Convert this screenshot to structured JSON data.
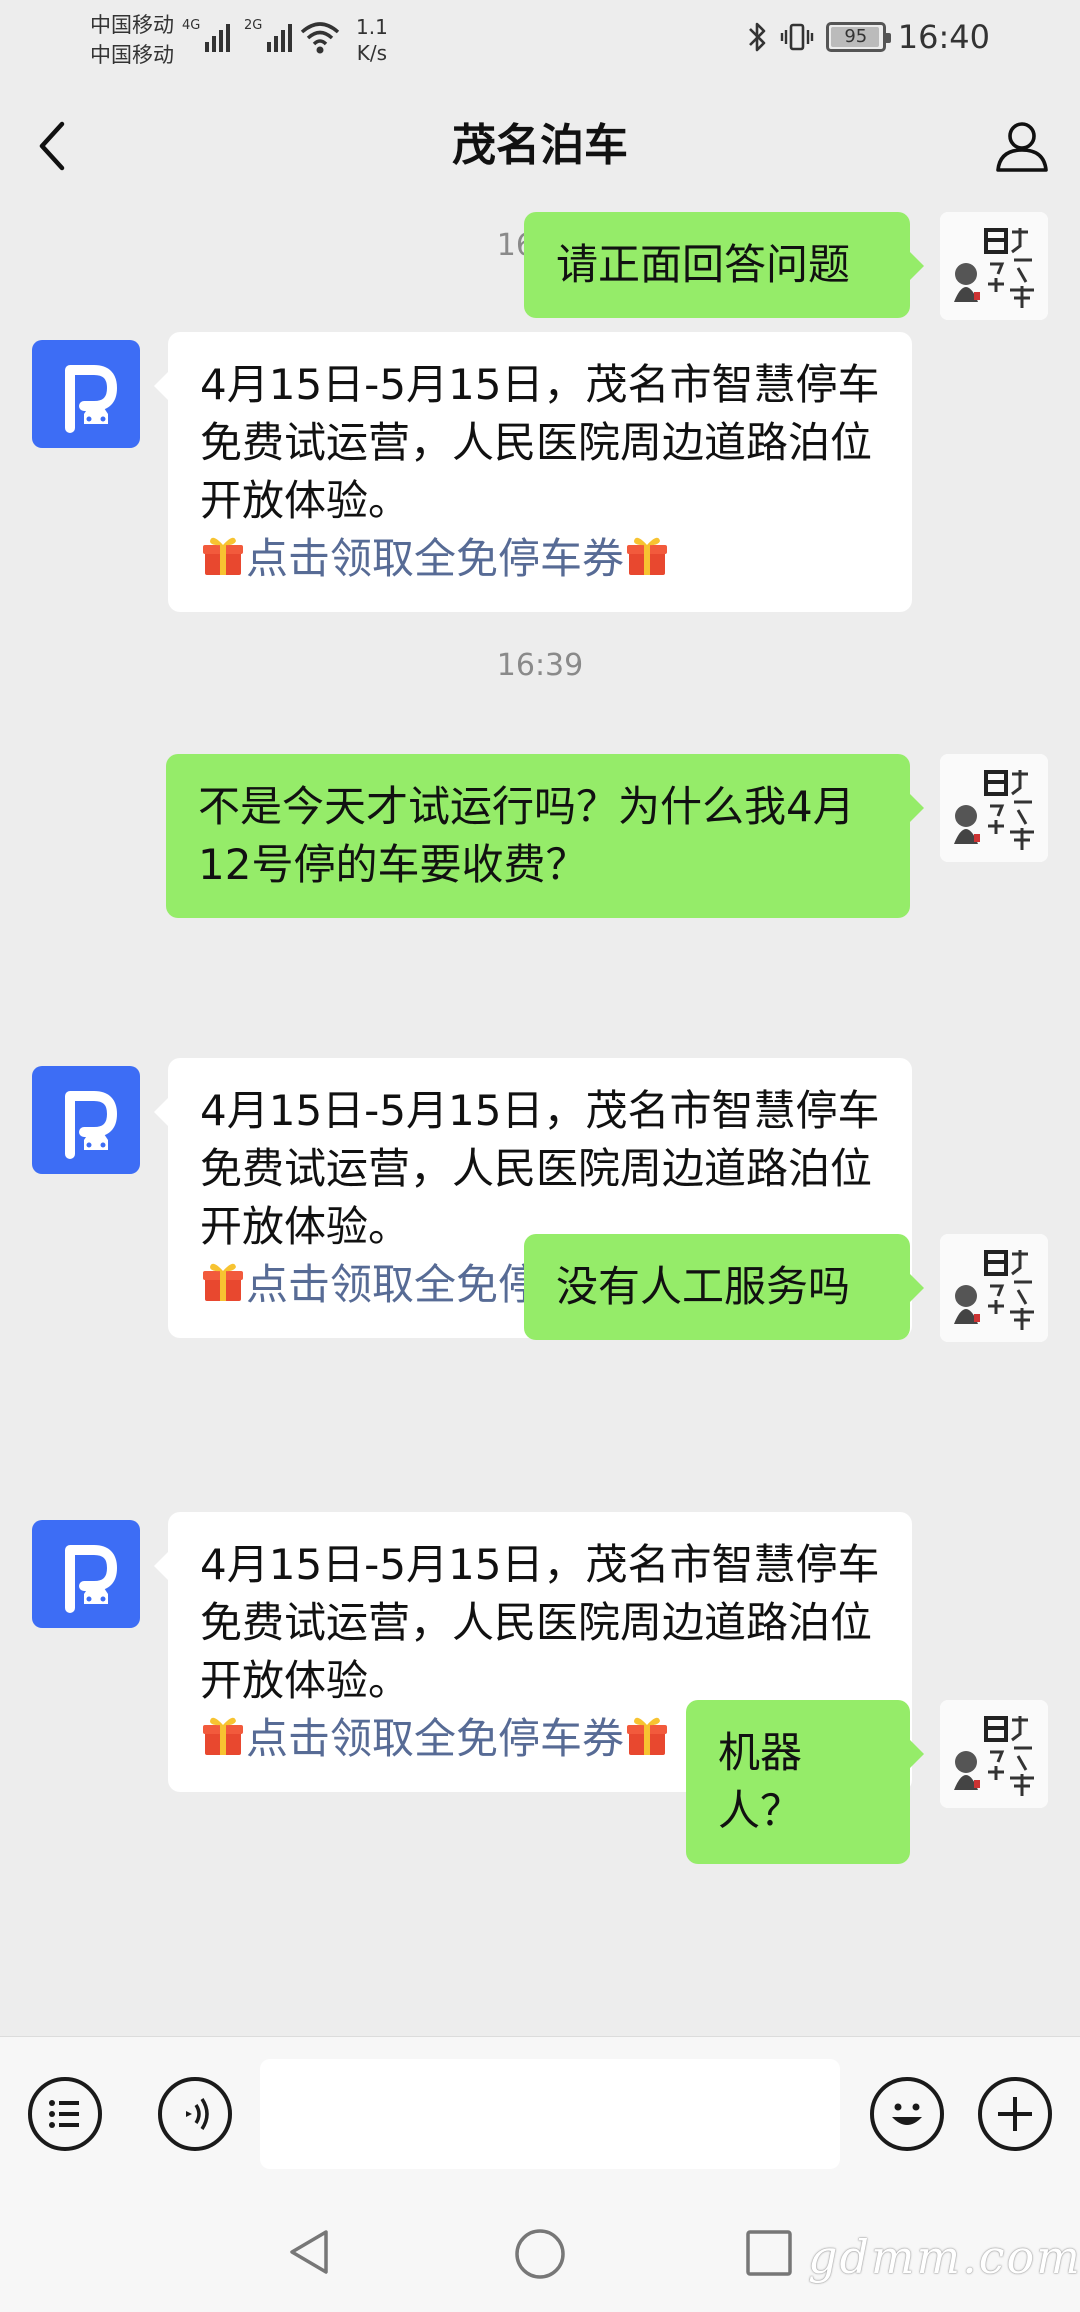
{
  "status_bar": {
    "carrier_1": "中国移动",
    "carrier_2": "中国移动",
    "network_1": "4G",
    "network_2": "2G",
    "speed_value": "1.1",
    "speed_unit": "K/s",
    "battery": "95",
    "time": "16:40"
  },
  "header": {
    "title": "茂名泊车",
    "back_icon": "chevron-left-icon",
    "profile_icon": "person-icon"
  },
  "colors": {
    "app_bg": "#ededed",
    "sent_bubble": "#95ec69",
    "received_bubble": "#ffffff",
    "link": "#576b95",
    "bot_avatar": "#3d6df5"
  },
  "messages": [
    {
      "type": "time",
      "text": "16:23"
    },
    {
      "type": "received",
      "sender": "bot",
      "text": "4月15日-5月15日，茂名市智慧停车免费试运营，人民医院周边道路泊位开放体验。",
      "link": "点击领取全免停车券"
    },
    {
      "type": "time",
      "text": "16:39"
    },
    {
      "type": "sent",
      "text": "不是今天才试运行吗？为什么我4月12号停的车要收费？"
    },
    {
      "type": "received",
      "sender": "bot",
      "text": "4月15日-5月15日，茂名市智慧停车免费试运营，人民医院周边道路泊位开放体验。",
      "link": "点击领取全免停车券"
    },
    {
      "type": "sent",
      "text": "没有人工服务吗"
    },
    {
      "type": "received",
      "sender": "bot",
      "text": "4月15日-5月15日，茂名市智慧停车免费试运营，人民医院周边道路泊位开放体验。",
      "link": "点击领取全免停车券"
    },
    {
      "type": "sent",
      "text": "机器人？"
    },
    {
      "type": "sent",
      "text": "请正面回答问题"
    }
  ],
  "input_bar": {
    "left_icons": [
      "list-icon",
      "voice-icon"
    ],
    "right_icons": [
      "emoji-icon",
      "plus-icon"
    ],
    "input_value": ""
  },
  "nav_bar": {
    "icons": [
      "back-triangle-icon",
      "home-circle-icon",
      "recents-square-icon"
    ]
  },
  "watermark": "gdmm.com"
}
